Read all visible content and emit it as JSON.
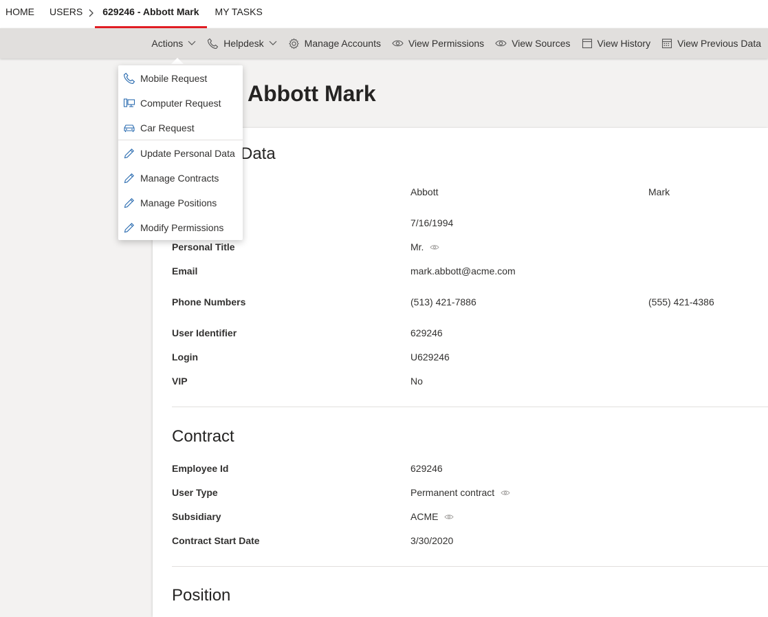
{
  "nav": {
    "home": "HOME",
    "users": "USERS",
    "current": "629246 - Abbott Mark",
    "tasks": "MY TASKS"
  },
  "commands": {
    "actions": "Actions",
    "helpdesk": "Helpdesk",
    "manage_accounts": "Manage Accounts",
    "view_permissions": "View Permissions",
    "view_sources": "View Sources",
    "view_history": "View History",
    "view_previous_data": "View Previous Data"
  },
  "menu": {
    "items": [
      {
        "label": "Mobile Request",
        "icon": "phone-icon"
      },
      {
        "label": "Computer Request",
        "icon": "computer-icon"
      },
      {
        "label": "Car Request",
        "icon": "car-icon"
      },
      {
        "label": "Update Personal Data",
        "icon": "pencil-icon"
      },
      {
        "label": "Manage Contracts",
        "icon": "pencil-icon"
      },
      {
        "label": "Manage Positions",
        "icon": "pencil-icon"
      },
      {
        "label": "Modify Permissions",
        "icon": "pencil-icon"
      }
    ]
  },
  "page_title": "Abbott Mark",
  "personal": {
    "title": "Data",
    "last_name": "Abbott",
    "first_name": "Mark",
    "birth_date": "7/16/1994",
    "personal_title_label": "Personal Title",
    "personal_title": "Mr.",
    "email_label": "Email",
    "email": "mark.abbott@acme.com",
    "phone_label": "Phone Numbers",
    "phone1": "(513) 421-7886",
    "phone2": "(555) 421-4386",
    "user_id_label": "User Identifier",
    "user_id": "629246",
    "login_label": "Login",
    "login": "U629246",
    "vip_label": "VIP",
    "vip": "No"
  },
  "contract": {
    "title": "Contract",
    "employee_id_label": "Employee Id",
    "employee_id": "629246",
    "user_type_label": "User Type",
    "user_type": "Permanent contract",
    "subsidiary_label": "Subsidiary",
    "subsidiary": "ACME",
    "start_date_label": "Contract Start Date",
    "start_date": "3/30/2020"
  },
  "position": {
    "title": "Position"
  },
  "colors": {
    "accent": "#e31e24",
    "icon_blue": "#2b6cb0"
  }
}
